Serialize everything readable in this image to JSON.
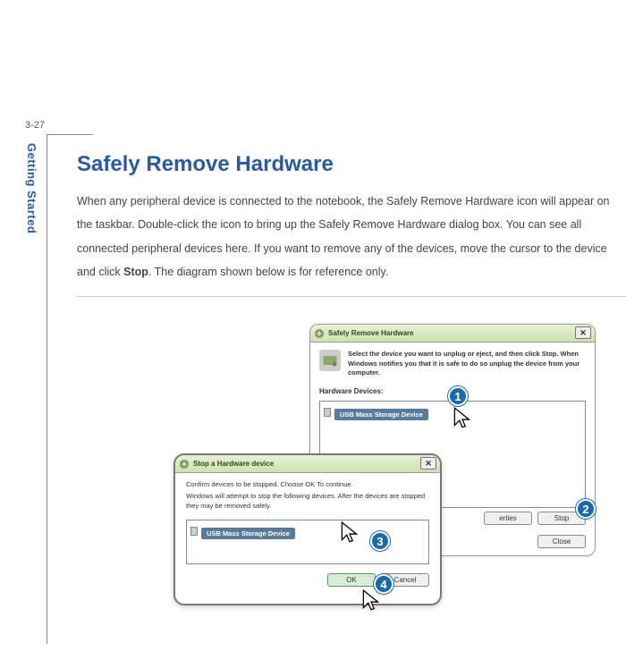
{
  "page_number": "3-27",
  "sidebar_label": "Getting Started",
  "title": "Safely Remove Hardware",
  "body_html": "When any peripheral device is connected to the notebook, the Safely Remove Hardware icon will appear on the taskbar.   Double-click the icon to bring up the Safely Remove Hardware dialog box. You can see all connected peripheral devices here.   If you want to remove any of the devices, move the cursor to the device and click ",
  "body_bold": "Stop",
  "body_tail": ".   The diagram shown below is for reference only.",
  "dialog1": {
    "title": "Safely Remove Hardware",
    "desc": "Select the device you want to unplug or eject, and then click Stop. When Windows notifies you that it is safe to do so unplug the device from your computer.",
    "list_label": "Hardware Devices:",
    "device": "USB Mass Storage Device",
    "btn_properties": "erties",
    "btn_stop": "Stop",
    "btn_close": "Close"
  },
  "dialog2": {
    "title": "Stop a Hardware device",
    "text1": "Confirm devices to be stopped.  Choose OK To continue.",
    "text2": "Windows will attempt to stop the following devices. After the devices are stopped they may be removed safely.",
    "device": "USB Mass Storage Device",
    "btn_ok": "OK",
    "btn_cancel": "Cancel"
  },
  "callouts": {
    "c1": "1",
    "c2": "2",
    "c3": "3",
    "c4": "4"
  }
}
